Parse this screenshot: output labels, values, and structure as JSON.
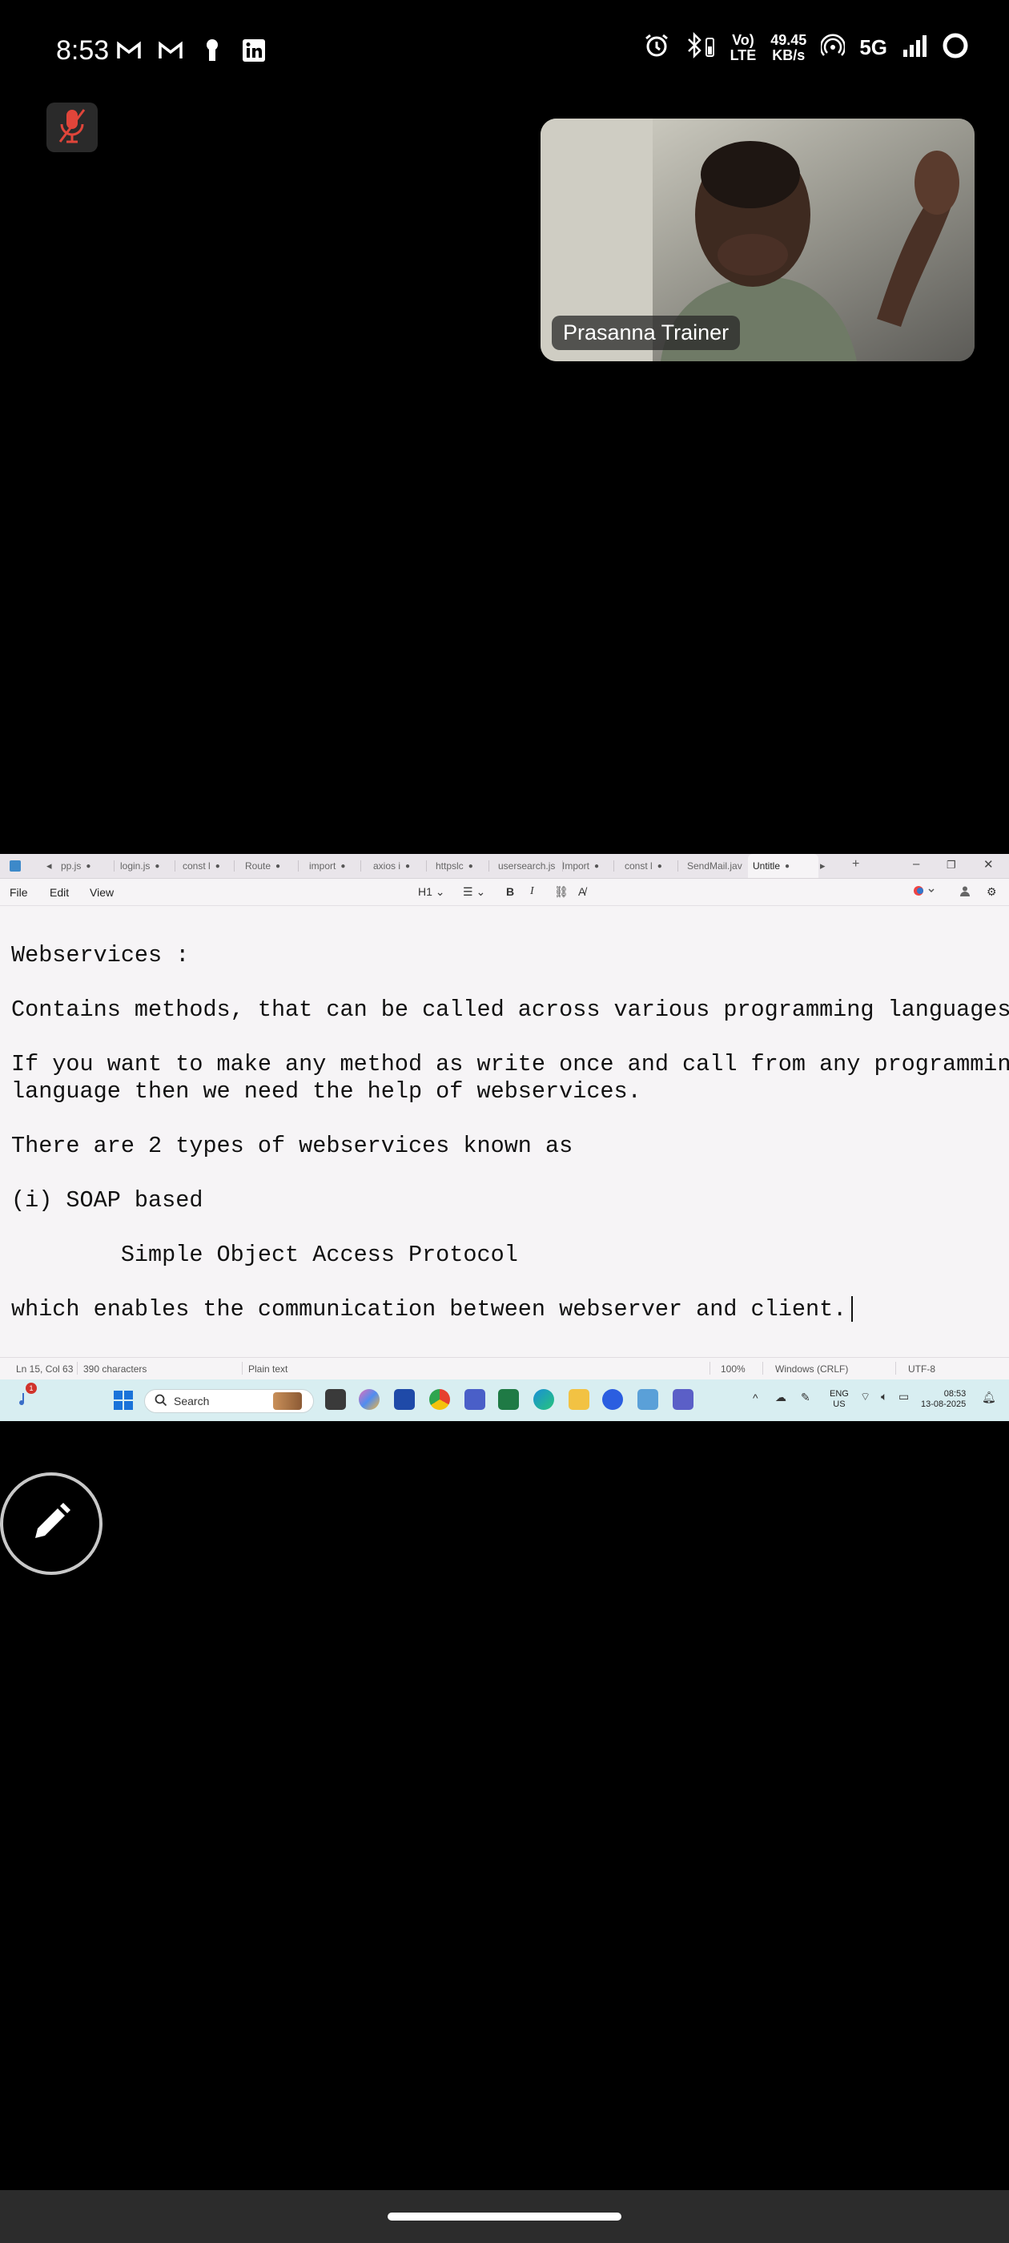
{
  "status_bar": {
    "time": "8:53",
    "left_icons": [
      "gmail-icon",
      "gmail-icon",
      "keyhole-icon",
      "linkedin-icon"
    ],
    "network_label_top": "Vo)",
    "network_label_bottom": "LTE",
    "speed_top": "49.45",
    "speed_bottom": "KB/s",
    "network_type": "5G"
  },
  "meeting": {
    "mic_state": "muted",
    "participant_name": "Prasanna Trainer"
  },
  "notepad": {
    "tabs": [
      {
        "label": "pp.js"
      },
      {
        "label": "login.js"
      },
      {
        "label": "const l"
      },
      {
        "label": "Route"
      },
      {
        "label": "import"
      },
      {
        "label": "axios i"
      },
      {
        "label": "httpslc"
      },
      {
        "label": "usersearch.js"
      },
      {
        "label": "Import"
      },
      {
        "label": "const l"
      },
      {
        "label": "SendMail.jav"
      },
      {
        "label": "Untitle",
        "active": true
      }
    ],
    "menu": {
      "file": "File",
      "edit": "Edit",
      "view": "View"
    },
    "format": {
      "heading": "H1",
      "bold": "B",
      "italic": "I"
    },
    "lines": [
      "Webservices :",
      "",
      "Contains methods, that can be called across various programming languages.",
      "",
      "If you want to make any method as write once and call from any programming",
      "language then we need the help of webservices.",
      "",
      "There are 2 types of webservices known as",
      "",
      "(i) SOAP based",
      "",
      "        Simple Object Access Protocol",
      "",
      "which enables the communication between webserver and client."
    ],
    "status": {
      "position": "Ln 15, Col 63",
      "characters": "390 characters",
      "mode": "Plain text",
      "zoom": "100%",
      "line_ending": "Windows (CRLF)",
      "encoding": "UTF-8"
    }
  },
  "taskbar": {
    "notification_count": "1",
    "search_placeholder": "Search",
    "lang_top": "ENG",
    "lang_bottom": "US",
    "clock_time": "08:53",
    "clock_date": "13-08-2025"
  },
  "colors": {
    "screen_bg": "#f6f4f6",
    "taskbar_bg": "#d8eef1",
    "mute_red": "#e0453a"
  }
}
